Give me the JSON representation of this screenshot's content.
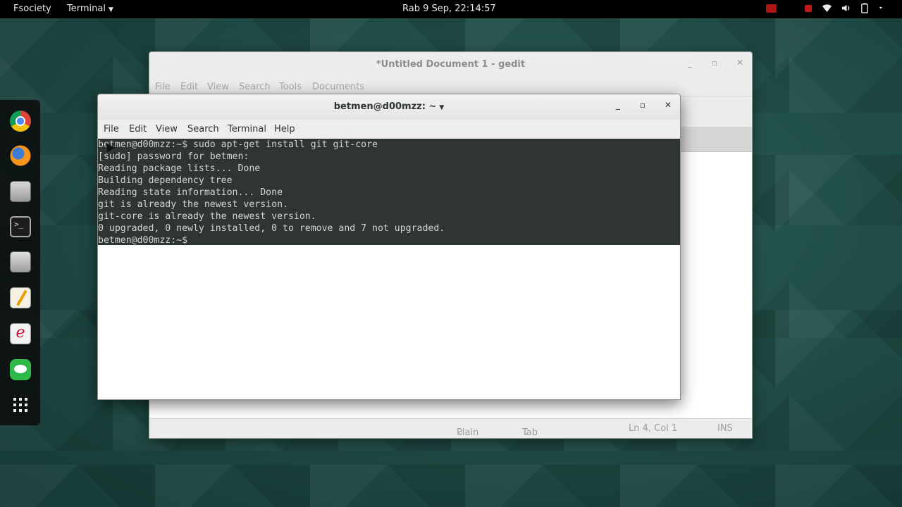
{
  "topbar": {
    "activities": "Fsociety",
    "app_menu": "Terminal",
    "clock": "Rab  9 Sep, 22:14:57"
  },
  "dock": {
    "items": [
      "chrome-icon",
      "firefox-icon",
      "files-icon",
      "terminal-icon",
      "mixer-icon",
      "gedit-icon",
      "editor-icon",
      "line-icon",
      "show-apps-icon"
    ]
  },
  "gedit": {
    "title": "*Untitled Document 1 - gedit",
    "menu": [
      "File",
      "Edit",
      "View",
      "Search",
      "Tools",
      "Documents"
    ],
    "status": {
      "language": "Plain Text",
      "tab_width": "Tab Width: 8",
      "position": "Ln 4, Col 1",
      "mode": "INS"
    }
  },
  "terminal": {
    "title": "betmen@d00mzz: ~",
    "menu": [
      "File",
      "Edit",
      "View",
      "Search",
      "Terminal",
      "Help"
    ],
    "lines": [
      "betmen@d00mzz:~$ sudo apt-get install git git-core",
      "[sudo] password for betmen:",
      "Reading package lists... Done",
      "Building dependency tree",
      "Reading state information... Done",
      "git is already the newest version.",
      "git-core is already the newest version.",
      "0 upgraded, 0 newly installed, 0 to remove and 7 not upgraded.",
      "betmen@d00mzz:~$"
    ]
  }
}
